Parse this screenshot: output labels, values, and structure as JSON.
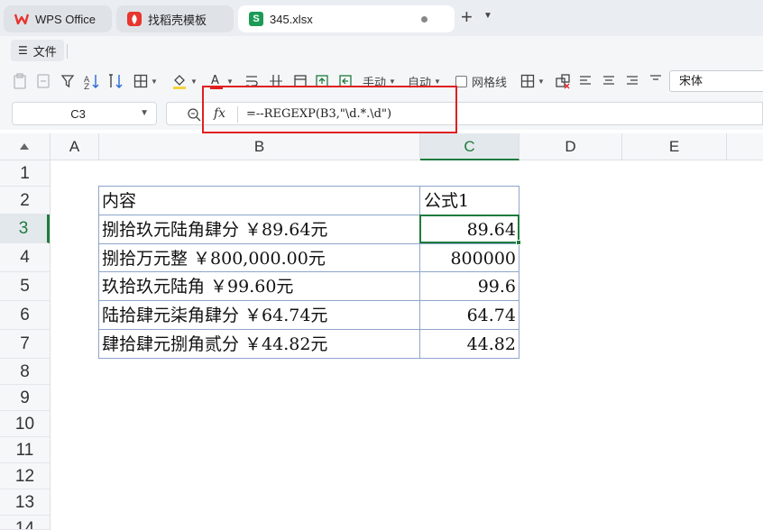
{
  "tabs": [
    {
      "label": "WPS Office",
      "icon": "wps-logo-icon",
      "color": "#e8352e"
    },
    {
      "label": "找稻壳模板",
      "icon": "docer-icon",
      "color": "#e8352e"
    },
    {
      "label": "345.xlsx",
      "icon": "spreadsheet-s-icon",
      "color": "#1c9b56"
    }
  ],
  "menu": {
    "file_label": "文件"
  },
  "toolbar": {
    "manual_label": "手动",
    "auto_label": "自动",
    "gridlines_label": "网格线",
    "font_name": "宋体"
  },
  "formula_bar": {
    "cell_ref": "C3",
    "fx_label": "fx",
    "formula": "=--REGEXP(B3,\"\\d.*.\\d\")"
  },
  "sheet": {
    "columns": [
      "A",
      "B",
      "C",
      "D",
      "E"
    ],
    "rows": [
      "1",
      "2",
      "3",
      "4",
      "5",
      "6",
      "7",
      "8",
      "9",
      "10",
      "11",
      "12",
      "13",
      "14"
    ],
    "header": {
      "b": "内容",
      "c": "公式1"
    },
    "data": [
      {
        "b": "捌拾玖元陆角肆分  ￥89.64元",
        "c": "89.64"
      },
      {
        "b": "捌拾万元整  ￥800,000.00元",
        "c": "800000"
      },
      {
        "b": "玖拾玖元陆角  ￥99.60元",
        "c": "99.6"
      },
      {
        "b": "陆拾肆元柒角肆分  ￥64.74元",
        "c": "64.74"
      },
      {
        "b": "肆拾肆元捌角贰分  ￥44.82元",
        "c": "44.82"
      }
    ],
    "selected_color": "#1e7b3c",
    "border_color": "#8ea5cb"
  },
  "annotation": {
    "highlight_color": "#e02020"
  }
}
